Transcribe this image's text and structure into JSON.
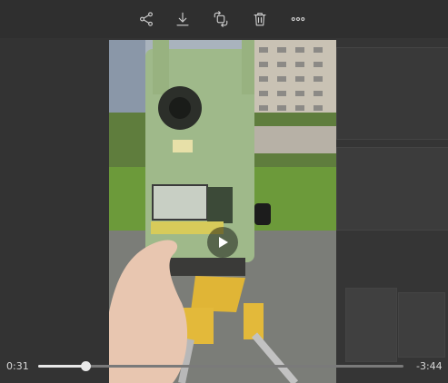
{
  "toolbar": {
    "actions": [
      "share-icon",
      "download-icon",
      "rotate-icon",
      "delete-icon",
      "more-icon"
    ]
  },
  "player": {
    "current_time": "0:31",
    "remaining_time": "-3:44",
    "progress": 0.13,
    "state": "paused"
  },
  "colors": {
    "background": "#2b2b2b",
    "toolbar": "#2f2f2f",
    "progress_fill": "#e8e8e8",
    "progress_track": "#7a7a7a"
  }
}
